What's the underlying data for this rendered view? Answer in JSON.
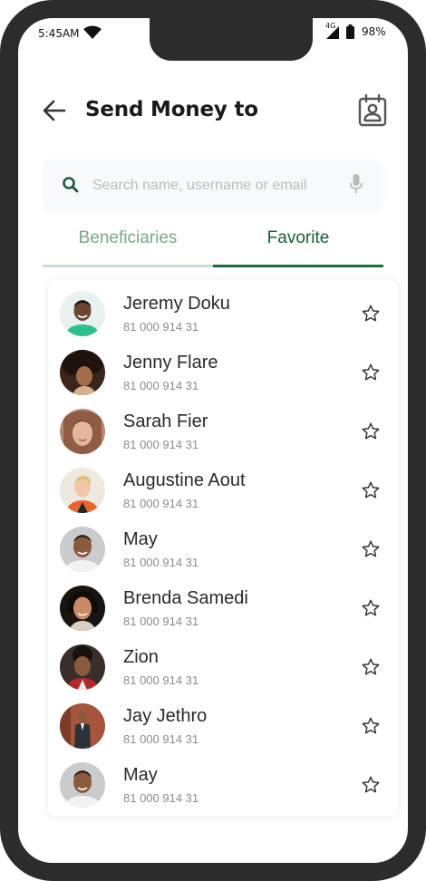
{
  "status_bar": {
    "time": "5:45AM",
    "network": "4G",
    "battery": "98%"
  },
  "header": {
    "title": "Send Money to"
  },
  "search": {
    "placeholder": "Search name, username or email"
  },
  "tabs": [
    {
      "label": "Beneficiaries",
      "active": false
    },
    {
      "label": "Favorite",
      "active": true
    }
  ],
  "contacts": [
    {
      "name": "Jeremy Doku",
      "number": "81 000 914 31"
    },
    {
      "name": "Jenny Flare",
      "number": "81 000 914 31"
    },
    {
      "name": "Sarah Fier",
      "number": "81 000 914 31"
    },
    {
      "name": "Augustine Aout",
      "number": "81 000 914 31"
    },
    {
      "name": "May",
      "number": "81 000 914 31"
    },
    {
      "name": "Brenda Samedi",
      "number": "81 000 914 31"
    },
    {
      "name": "Zion",
      "number": "81 000 914 31"
    },
    {
      "name": "Jay Jethro",
      "number": "81 000 914 31"
    },
    {
      "name": "May",
      "number": "81 000 914 31"
    }
  ],
  "colors": {
    "accent": "#1f6a3f",
    "accent_light": "#c8dcd0",
    "frame": "#2c2c2c"
  }
}
